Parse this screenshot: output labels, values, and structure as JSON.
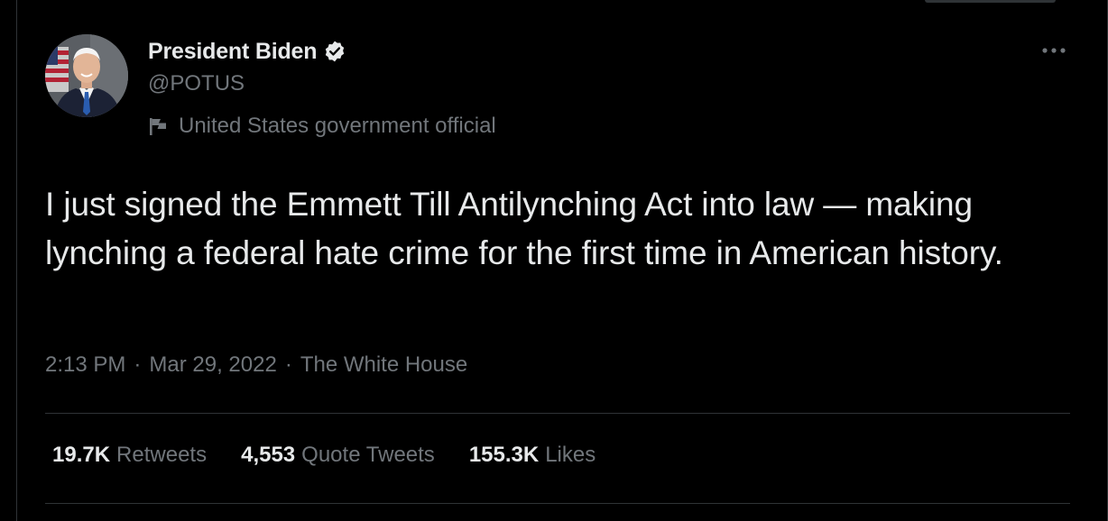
{
  "author": {
    "display_name": "President Biden",
    "handle": "@POTUS",
    "label": "United States government official"
  },
  "tweet": {
    "text": "I just signed the Emmett Till Antilynching Act into law — making lynching a federal hate crime for the first time in American history.",
    "time": "2:13 PM",
    "date": "Mar 29, 2022",
    "source": "The White House",
    "separator": "·"
  },
  "stats": {
    "retweets": {
      "value": "19.7K",
      "label": "Retweets"
    },
    "quote_tweets": {
      "value": "4,553",
      "label": "Quote Tweets"
    },
    "likes": {
      "value": "155.3K",
      "label": "Likes"
    }
  },
  "icons": {
    "verified": "verified-badge-icon",
    "more": "more-horizontal-icon",
    "label": "flag-icon"
  },
  "colors": {
    "background": "#000000",
    "text_primary": "#e7e9ea",
    "text_secondary": "#71767b",
    "border": "#2f3336",
    "verified_badge": "#e7e9ea"
  }
}
